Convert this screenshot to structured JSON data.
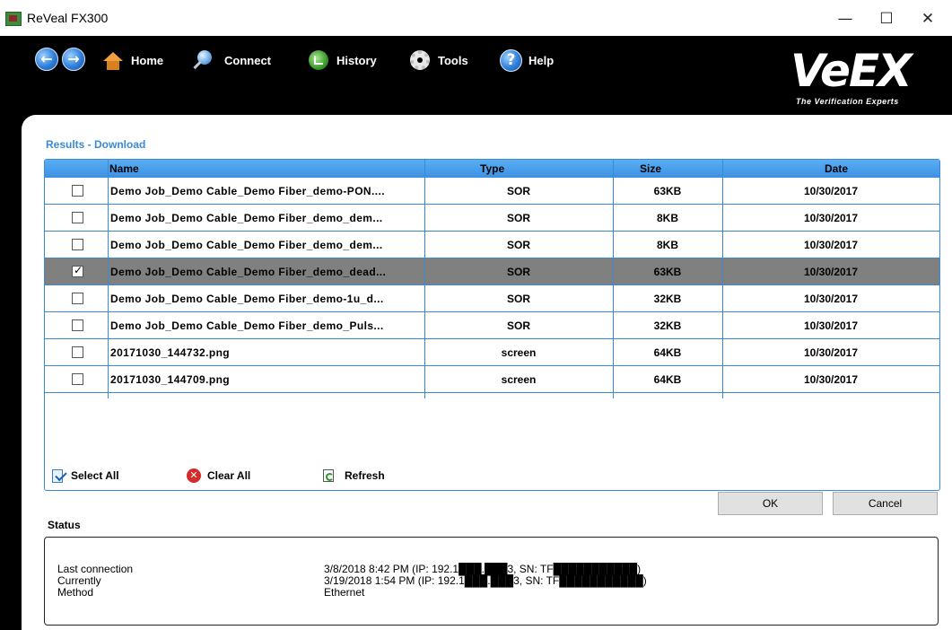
{
  "window": {
    "title": "ReVeal FX300",
    "min_glyph": "—",
    "max_glyph": "☐",
    "close_glyph": "✕"
  },
  "toolbar": {
    "back_glyph": "←",
    "forward_glyph": "→",
    "home_label": "Home",
    "connect_label": "Connect",
    "history_label": "History",
    "tools_label": "Tools",
    "help_label": "Help",
    "help_glyph": "?",
    "logo_text": "VeEX",
    "logo_tagline": "The Verification Experts"
  },
  "results": {
    "header": "Results - Download",
    "columns": {
      "name": "Name",
      "type": "Type",
      "size": "Size",
      "date": "Date"
    },
    "rows": [
      {
        "name": "Demo Job_Demo Cable_Demo Fiber_demo-PON....",
        "type": "SOR",
        "size": "63KB",
        "date": "10/30/2017",
        "checked": false
      },
      {
        "name": "Demo Job_Demo Cable_Demo Fiber_demo_dem...",
        "type": "SOR",
        "size": "8KB",
        "date": "10/30/2017",
        "checked": false
      },
      {
        "name": "Demo Job_Demo Cable_Demo Fiber_demo_dem...",
        "type": "SOR",
        "size": "8KB",
        "date": "10/30/2017",
        "checked": false
      },
      {
        "name": "Demo Job_Demo Cable_Demo Fiber_demo_dead...",
        "type": "SOR",
        "size": "63KB",
        "date": "10/30/2017",
        "checked": true
      },
      {
        "name": "Demo Job_Demo Cable_Demo Fiber_demo-1u_d...",
        "type": "SOR",
        "size": "32KB",
        "date": "10/30/2017",
        "checked": false
      },
      {
        "name": "Demo Job_Demo Cable_Demo Fiber_demo_Puls...",
        "type": "SOR",
        "size": "32KB",
        "date": "10/30/2017",
        "checked": false
      },
      {
        "name": "20171030_144732.png",
        "type": "screen",
        "size": "64KB",
        "date": "10/30/2017",
        "checked": false
      },
      {
        "name": "20171030_144709.png",
        "type": "screen",
        "size": "64KB",
        "date": "10/30/2017",
        "checked": false
      }
    ],
    "select_all_label": "Select All",
    "clear_all_label": "Clear All",
    "refresh_label": "Refresh"
  },
  "buttons": {
    "ok_label": "OK",
    "cancel_label": "Cancel"
  },
  "status": {
    "label": "Status",
    "last_connection_label": "Last connection",
    "last_connection_value": "3/8/2018 8:42 PM  (IP: 192.1███.███3, SN: TF███████████)",
    "currently_label": "Currently",
    "currently_value": "3/19/2018 1:54 PM  (IP: 192.1███.███3, SN: TF███████████)",
    "method_label": "Method",
    "method_value": "Ethernet"
  },
  "colors": {
    "accent": "#3a8ad8",
    "header_gradient_top": "#5aaef4",
    "selected_row": "#808080",
    "frame": "#000000"
  }
}
